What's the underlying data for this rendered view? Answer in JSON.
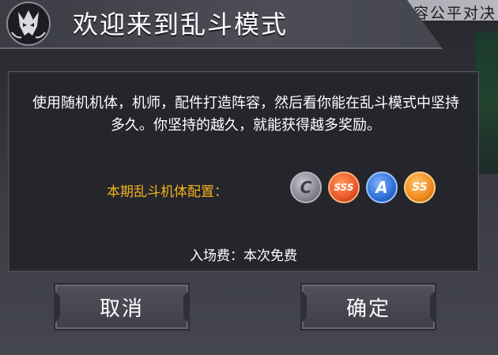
{
  "header": {
    "title": "欢迎来到乱斗模式",
    "logo_icon": "wolf-emblem-icon"
  },
  "background": {
    "ticker_text": "乐周日开启   随机分配阵容公平对决"
  },
  "dialog": {
    "description": "使用随机机体，机师，配件打造阵容，然后看你能在乱斗模式中坚持多久。你坚持的越久，就能获得越多奖励。",
    "config_label": "本期乱斗机体配置：",
    "rank_badges": [
      "C",
      "SSS",
      "A",
      "SS"
    ],
    "entry_fee": "入场费：本次免费"
  },
  "buttons": {
    "cancel_label": "取消",
    "confirm_label": "确定"
  },
  "colors": {
    "accent_gold": "#f2b21b",
    "panel_bg": "#25262c",
    "badge_c": "#8d8d98",
    "badge_sss": "#e9572a",
    "badge_a": "#2f6fd6",
    "badge_ss": "#f08a1e"
  }
}
